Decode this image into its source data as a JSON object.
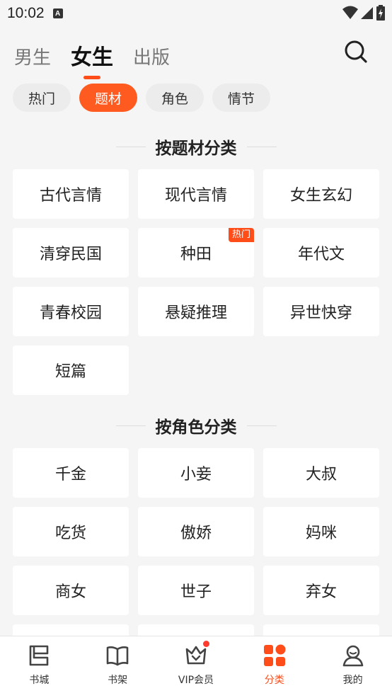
{
  "status": {
    "time": "10:02",
    "notif_letter": "A"
  },
  "top_tabs": [
    "男生",
    "女生",
    "出版"
  ],
  "chips": [
    "热门",
    "题材",
    "角色",
    "情节"
  ],
  "sections": [
    {
      "title": "按题材分类",
      "items": [
        {
          "label": "古代言情",
          "badge": ""
        },
        {
          "label": "现代言情",
          "badge": ""
        },
        {
          "label": "女生玄幻",
          "badge": ""
        },
        {
          "label": "清穿民国",
          "badge": ""
        },
        {
          "label": "种田",
          "badge": "热门"
        },
        {
          "label": "年代文",
          "badge": ""
        },
        {
          "label": "青春校园",
          "badge": ""
        },
        {
          "label": "悬疑推理",
          "badge": ""
        },
        {
          "label": "异世快穿",
          "badge": ""
        },
        {
          "label": "短篇",
          "badge": ""
        }
      ]
    },
    {
      "title": "按角色分类",
      "items": [
        {
          "label": "千金",
          "badge": ""
        },
        {
          "label": "小妾",
          "badge": ""
        },
        {
          "label": "大叔",
          "badge": ""
        },
        {
          "label": "吃货",
          "badge": ""
        },
        {
          "label": "傲娇",
          "badge": ""
        },
        {
          "label": "妈咪",
          "badge": ""
        },
        {
          "label": "商女",
          "badge": ""
        },
        {
          "label": "世子",
          "badge": ""
        },
        {
          "label": "弃女",
          "badge": ""
        }
      ]
    }
  ],
  "bottom_nav": [
    {
      "label": "书城",
      "icon": "bookstore-icon"
    },
    {
      "label": "书架",
      "icon": "bookshelf-icon"
    },
    {
      "label": "VIP会员",
      "icon": "vip-crown-icon"
    },
    {
      "label": "分类",
      "icon": "category-grid-icon"
    },
    {
      "label": "我的",
      "icon": "profile-icon"
    }
  ],
  "colors": {
    "accent": "#ff4d1a",
    "chip_active": "#ff5a1f",
    "background": "#f5f5f5"
  }
}
